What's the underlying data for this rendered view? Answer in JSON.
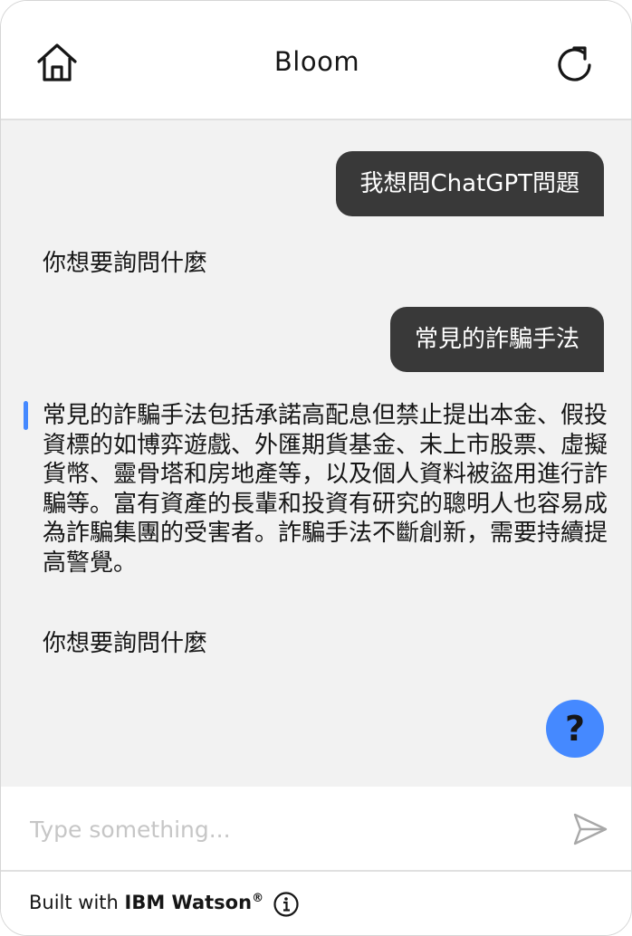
{
  "header": {
    "title": "Bloom",
    "home_icon": "home-icon",
    "restart_icon": "restart-icon"
  },
  "messages": [
    {
      "role": "user",
      "text": "我想問ChatGPT問題"
    },
    {
      "role": "bot",
      "text": "你想要詢問什麼"
    },
    {
      "role": "user",
      "text": "常見的詐騙手法"
    },
    {
      "role": "bot",
      "text": "常見的詐騙手法包括承諾高配息但禁止提出本金、假投資標的如博弈遊戲、外匯期貨基金、未上市股票、虛擬貨幣、靈骨塔和房地產等，以及個人資料被盜用進行詐騙等。富有資產的長輩和投資有研究的聰明人也容易成為詐騙集團的受害者。詐騙手法不斷創新，需要持續提高警覺。"
    },
    {
      "role": "bot",
      "text": "你想要詢問什麼"
    }
  ],
  "help_button": {
    "label": "?"
  },
  "input": {
    "placeholder": "Type something...",
    "value": ""
  },
  "footer": {
    "prefix": "Built with ",
    "brand": "IBM Watson",
    "registered": "®",
    "info_icon": "info-icon"
  },
  "colors": {
    "accent": "#4589ff",
    "user_bubble": "#393939",
    "chat_background": "#f2f2f2"
  }
}
